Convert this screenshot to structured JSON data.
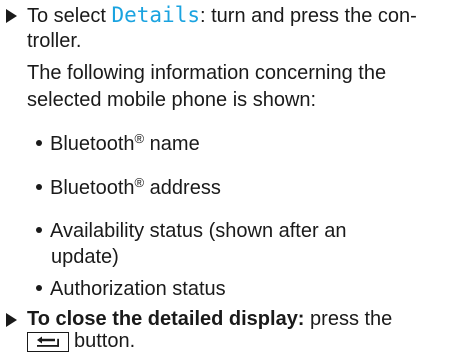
{
  "step1": {
    "prefix": "To select ",
    "keyword": "Details",
    "suffix_line1": ": turn and press the con-",
    "line2": "troller.",
    "line3": "The following information concerning the",
    "line4": "selected mobile phone is shown:"
  },
  "bullets": [
    {
      "text": "Bluetooth",
      "sup": "®",
      "rest": " name"
    },
    {
      "text": "Bluetooth",
      "sup": "®",
      "rest": " address"
    },
    {
      "text": "Availability status (shown after an",
      "line2": "update)"
    },
    {
      "text": "Authorization status"
    }
  ],
  "step2": {
    "bold": "To close the detailed display:",
    "rest": " press the",
    "line2_rest": " button.",
    "key_icon": "back-arrow-icon"
  }
}
